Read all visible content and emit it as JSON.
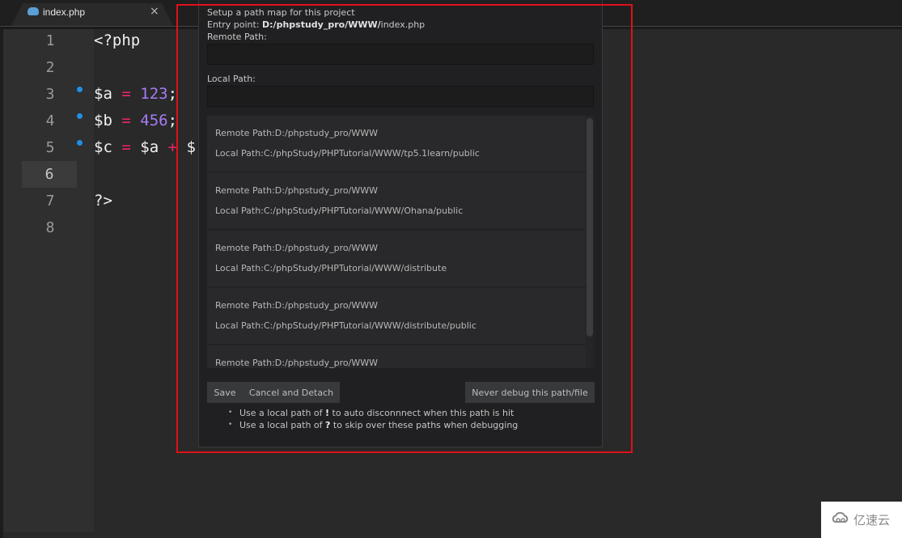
{
  "tab": {
    "icon": "php-elephant-icon",
    "label": "index.php",
    "close_glyph": "×"
  },
  "editor": {
    "line_numbers": [
      "1",
      "2",
      "3",
      "4",
      "5",
      "6",
      "7",
      "8"
    ],
    "active_line": "6",
    "breakpoint_lines": [
      "3",
      "4",
      "5"
    ],
    "lines": {
      "l1": "<?php",
      "l3_var": "$a",
      "l3_op": "=",
      "l3_num": "123",
      "l3_end": ";",
      "l4_var": "$b",
      "l4_op": "=",
      "l4_num": "456",
      "l4_end": ";",
      "l5_var": "$c",
      "l5_op": "=",
      "l5_a": "$a",
      "l5_plus": "+",
      "l5_b": "$",
      "l7": "?>"
    },
    "colors": {
      "operator": "#f0246a",
      "number": "#a57cf5",
      "breakpoint": "#1e90e6"
    }
  },
  "dialog": {
    "title": "Setup a path map for this project",
    "entry_label": "Entry point: ",
    "entry_bold": "D:/phpstudy_pro/WWW/",
    "entry_file": "index.php",
    "remote_label": "Remote Path:",
    "remote_value": "",
    "local_label": "Local Path:",
    "local_value": "",
    "mappings": [
      {
        "remote": "Remote Path:D:/phpstudy_pro/WWW",
        "local": "Local Path:C:/phpStudy/PHPTutorial/WWW/tp5.1learn/public"
      },
      {
        "remote": "Remote Path:D:/phpstudy_pro/WWW",
        "local": "Local Path:C:/phpStudy/PHPTutorial/WWW/Ohana/public"
      },
      {
        "remote": "Remote Path:D:/phpstudy_pro/WWW",
        "local": "Local Path:C:/phpStudy/PHPTutorial/WWW/distribute"
      },
      {
        "remote": "Remote Path:D:/phpstudy_pro/WWW",
        "local": "Local Path:C:/phpStudy/PHPTutorial/WWW/distribute/public"
      },
      {
        "remote": "Remote Path:D:/phpstudy_pro/WWW",
        "local": ""
      }
    ],
    "buttons": {
      "save": "Save",
      "cancel": "Cancel and Detach",
      "never": "Never debug this path/file"
    },
    "tips": [
      {
        "pre": "Use a local path of ",
        "sym": "!",
        "post": " to auto disconnnect when this path is hit"
      },
      {
        "pre": "Use a local path of ",
        "sym": "?",
        "post": " to skip over these paths when debugging"
      }
    ]
  },
  "annotation": {
    "highlight_color": "#e0101a"
  },
  "watermark": {
    "icon": "cloud-logo-icon",
    "text": "亿速云"
  }
}
